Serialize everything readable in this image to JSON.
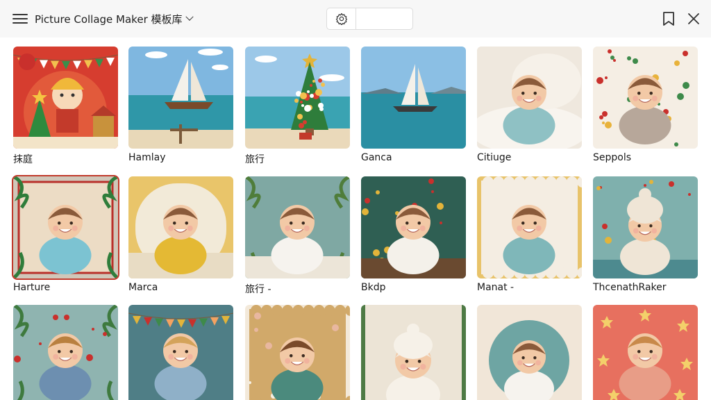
{
  "header": {
    "title": "Picture Collage Maker 模板库",
    "icons": {
      "menu": "hamburger-menu-icon",
      "settings": "gear-icon",
      "bookmark": "bookmark-icon",
      "close": "close-icon"
    }
  },
  "templates": [
    {
      "label": "抹庭",
      "theme": "christmas-cartoon"
    },
    {
      "label": "Hamlay",
      "theme": "sailboat-beach"
    },
    {
      "label": "旅行",
      "theme": "christmas-tree-beach"
    },
    {
      "label": "Ganca",
      "theme": "sailboat-sea"
    },
    {
      "label": "Citiuge",
      "theme": "baby-cream"
    },
    {
      "label": "Seppols",
      "theme": "baby-dots"
    },
    {
      "label": "Harture",
      "theme": "baby-palm-frame"
    },
    {
      "label": "Marca",
      "theme": "baby-yellow"
    },
    {
      "label": "旅行 -",
      "theme": "baby-teal-leaves"
    },
    {
      "label": "Bkdp",
      "theme": "baby-christmas-frame"
    },
    {
      "label": "Manat -",
      "theme": "baby-scalloped"
    },
    {
      "label": "ThcenathRaker",
      "theme": "baby-knit-hat"
    },
    {
      "label": "",
      "theme": "kid-palm"
    },
    {
      "label": "",
      "theme": "kid-bunting"
    },
    {
      "label": "",
      "theme": "kid-flowers"
    },
    {
      "label": "",
      "theme": "baby-white-hat"
    },
    {
      "label": "",
      "theme": "baby-teal-scallop"
    },
    {
      "label": "",
      "theme": "kid-stars"
    }
  ],
  "colors": {
    "topbar": "#f7f7f7",
    "selected_border": "#c0392b"
  }
}
